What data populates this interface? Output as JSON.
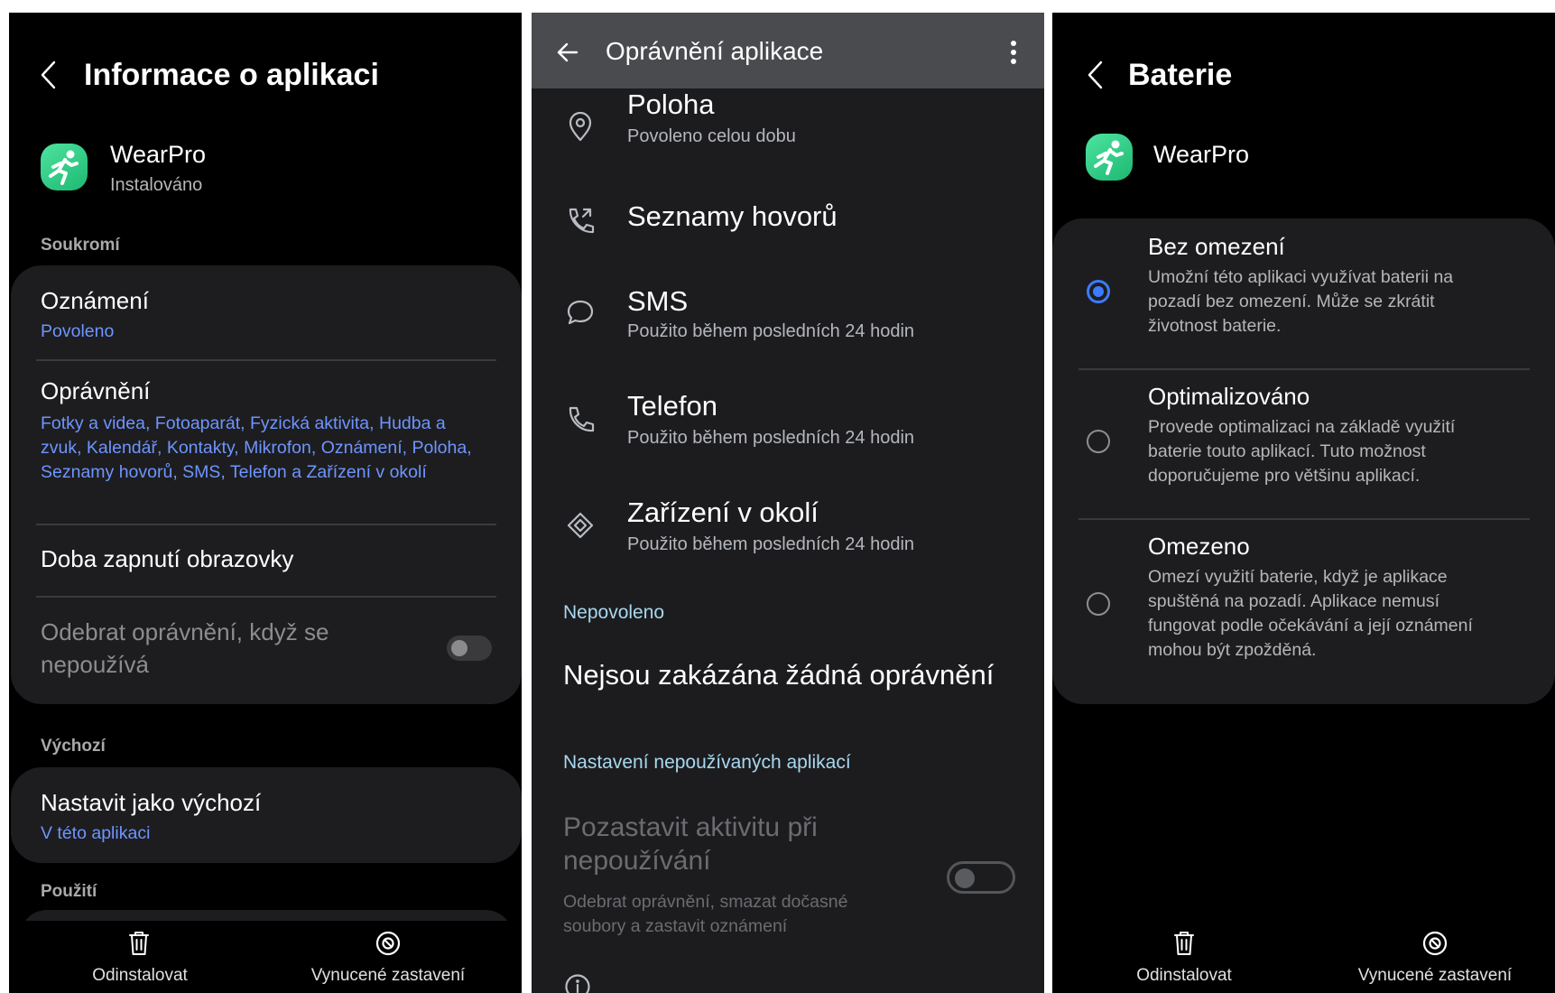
{
  "panel1": {
    "header_title": "Informace o aplikaci",
    "app_name": "WearPro",
    "app_status": "Instalováno",
    "section_privacy": "Soukromí",
    "notifications": {
      "title": "Oznámení",
      "value": "Povoleno"
    },
    "permissions": {
      "title": "Oprávnění",
      "value": "Fotky a videa, Fotoaparát, Fyzická aktivita, Hudba a zvuk, Kalendář, Kontakty, Mikrofon, Oznámení, Poloha, Seznamy hovorů, SMS, Telefon a Zařízení v okolí"
    },
    "screen_time": {
      "title": "Doba zapnutí obrazovky"
    },
    "remove_permissions": {
      "title": "Odebrat oprávnění, když se nepoužívá",
      "enabled": false
    },
    "section_default": "Výchozí",
    "set_default": {
      "title": "Nastavit jako výchozí",
      "value": "V této aplikaci"
    },
    "section_usage": "Použití",
    "bottom": {
      "uninstall": "Odinstalovat",
      "force_stop": "Vynucené zastavení"
    }
  },
  "panel2": {
    "header_title": "Oprávnění aplikace",
    "items": [
      {
        "icon": "location-pin-icon",
        "title": "Poloha",
        "sub": "Povoleno celou dobu"
      },
      {
        "icon": "call-log-icon",
        "title": "Seznamy hovorů",
        "sub": ""
      },
      {
        "icon": "sms-bubble-icon",
        "title": "SMS",
        "sub": "Použito během posledních 24 hodin"
      },
      {
        "icon": "phone-icon",
        "title": "Telefon",
        "sub": "Použito během posledních 24 hodin"
      },
      {
        "icon": "nearby-devices-icon",
        "title": "Zařízení v okolí",
        "sub": "Použito během posledních 24 hodin"
      }
    ],
    "section_denied": "Nepovoleno",
    "none_denied": "Nejsou zakázána žádná oprávnění",
    "section_unused": "Nastavení nepoužívaných aplikací",
    "pause_activity": {
      "title": "Pozastavit aktivitu při nepoužívání",
      "sub": "Odebrat oprávnění, smazat dočasné soubory a zastavit oznámení",
      "enabled": false
    }
  },
  "panel3": {
    "header_title": "Baterie",
    "app_name": "WearPro",
    "options": [
      {
        "title": "Bez omezení",
        "desc": "Umožní této aplikaci využívat baterii na pozadí bez omezení. Může se zkrátit životnost baterie.",
        "selected": true
      },
      {
        "title": "Optimalizováno",
        "desc": "Provede optimalizaci na základě využití baterie touto aplikací. Tuto možnost doporučujeme pro většinu aplikací.",
        "selected": false
      },
      {
        "title": "Omezeno",
        "desc": "Omezí využití baterie, když je aplikace spuštěná na pozadí. Aplikace nemusí fungovat podle očekávání a její oznámení mohou být zpožděná.",
        "selected": false
      }
    ],
    "bottom": {
      "uninstall": "Odinstalovat",
      "force_stop": "Vynucené zastavení"
    }
  },
  "colors": {
    "accent_blue": "#6e95ff",
    "radio_blue": "#3d7bff",
    "card_bg": "#1d1d1f",
    "app_icon_green": "#2fcb85"
  }
}
